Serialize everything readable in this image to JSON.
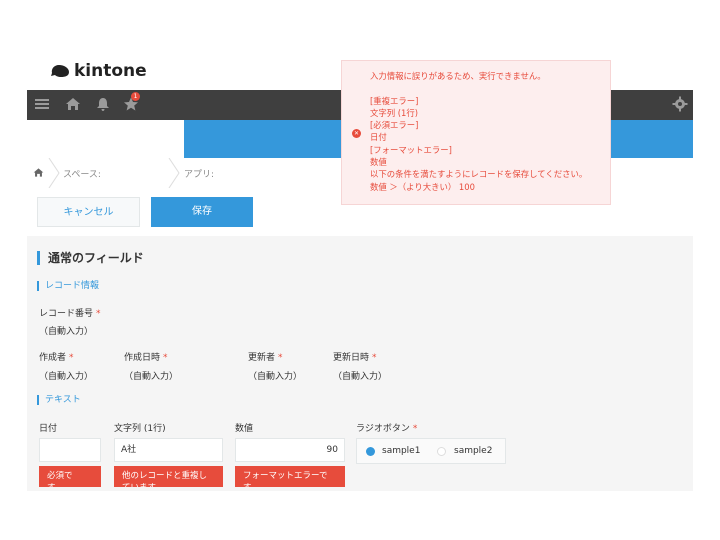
{
  "app": {
    "logo_text": "kintone"
  },
  "topbar": {
    "notification_count": "1"
  },
  "breadcrumb": {
    "space": "スペース:",
    "app": "アプリ:"
  },
  "toolbar": {
    "cancel_label": "キャンセル",
    "save_label": "保存"
  },
  "form": {
    "section_title": "通常のフィールド",
    "record_group": {
      "title": "レコード情報",
      "record_number_label": "レコード番号",
      "record_number_value": "（自動入力）",
      "creator_label": "作成者",
      "creator_value": "（自動入力）",
      "created_at_label": "作成日時",
      "created_at_value": "（自動入力）",
      "modifier_label": "更新者",
      "modifier_value": "（自動入力）",
      "modified_at_label": "更新日時",
      "modified_at_value": "（自動入力）"
    },
    "text_group": {
      "title": "テキスト",
      "date_label": "日付",
      "date_value": "",
      "date_error": "必須で\nす。",
      "text_label": "文字列 (1行)",
      "text_value": "A社",
      "text_error": "他のレコードと重複し\nています。",
      "number_label": "数値",
      "number_value": "90",
      "number_error": "フォーマットエラーで\nす。",
      "radio_label": "ラジオボタン",
      "radio_options": [
        "sample1",
        "sample2"
      ]
    }
  },
  "error_popup": {
    "lines": [
      "入力情報に誤りがあるため、実行できません。",
      "",
      "[重複エラー]",
      "文字列 (1行)",
      "[必須エラー]",
      "日付",
      "[フォーマットエラー]",
      "数値",
      "以下の条件を満たすようにレコードを保存してください。",
      "数値 ＞（より大きい） 100"
    ]
  },
  "colors": {
    "accent": "#3498db",
    "error": "#e74c3c",
    "topbar": "#3f3f3f"
  }
}
